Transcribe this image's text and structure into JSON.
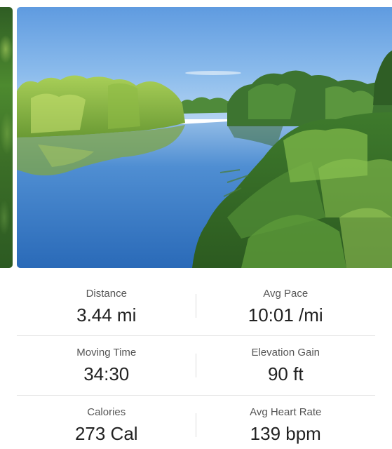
{
  "photos": {
    "previous": {
      "description": "previous-activity-photo"
    },
    "current": {
      "description": "river-landscape-photo"
    }
  },
  "stats": [
    {
      "label": "Distance",
      "value": "3.44 mi"
    },
    {
      "label": "Avg Pace",
      "value": "10:01 /mi"
    },
    {
      "label": "Moving Time",
      "value": "34:30"
    },
    {
      "label": "Elevation Gain",
      "value": "90 ft"
    },
    {
      "label": "Calories",
      "value": "273 Cal"
    },
    {
      "label": "Avg Heart Rate",
      "value": "139 bpm"
    }
  ]
}
